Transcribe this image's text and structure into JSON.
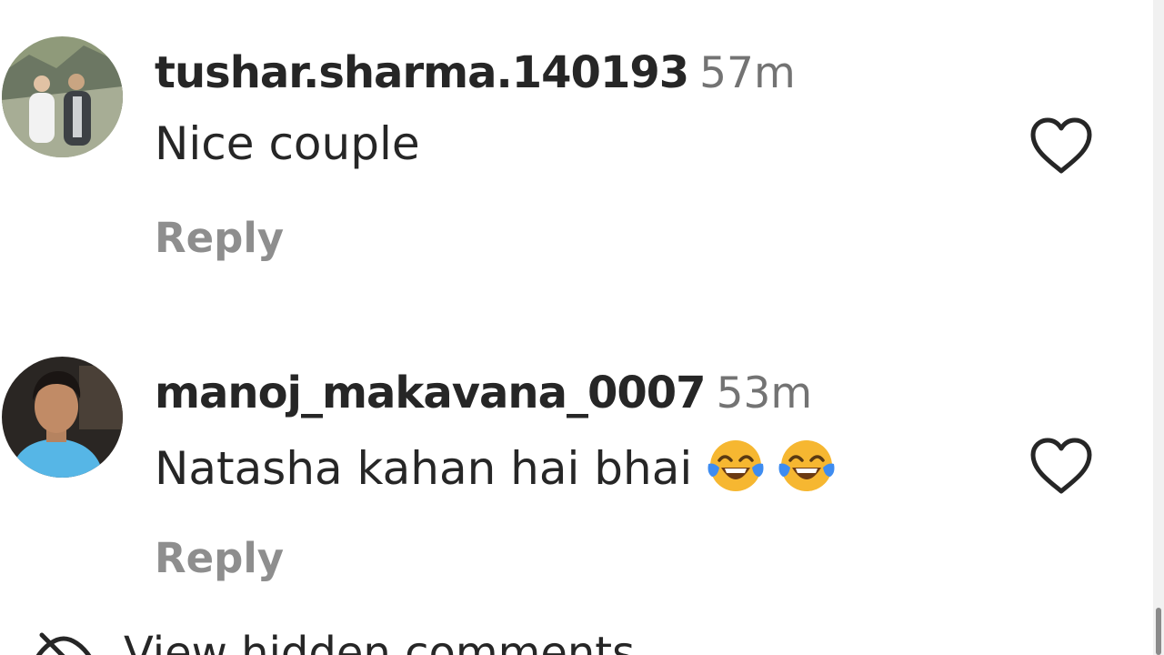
{
  "comments": [
    {
      "username": "tushar.sharma.140193",
      "time": "57m",
      "text": "Nice couple",
      "reply_label": "Reply"
    },
    {
      "username": "manoj_makavana_0007",
      "time": "53m",
      "text": "Natasha kahan hai bhai",
      "emojis": [
        "face-with-tears-of-joy",
        "face-with-tears-of-joy"
      ],
      "reply_label": "Reply"
    }
  ],
  "hidden_comments": {
    "label": "View hidden comments",
    "icon": "eye-off-icon"
  },
  "colors": {
    "text": "#262626",
    "secondary": "#737373",
    "reply": "#8e8e8e"
  }
}
